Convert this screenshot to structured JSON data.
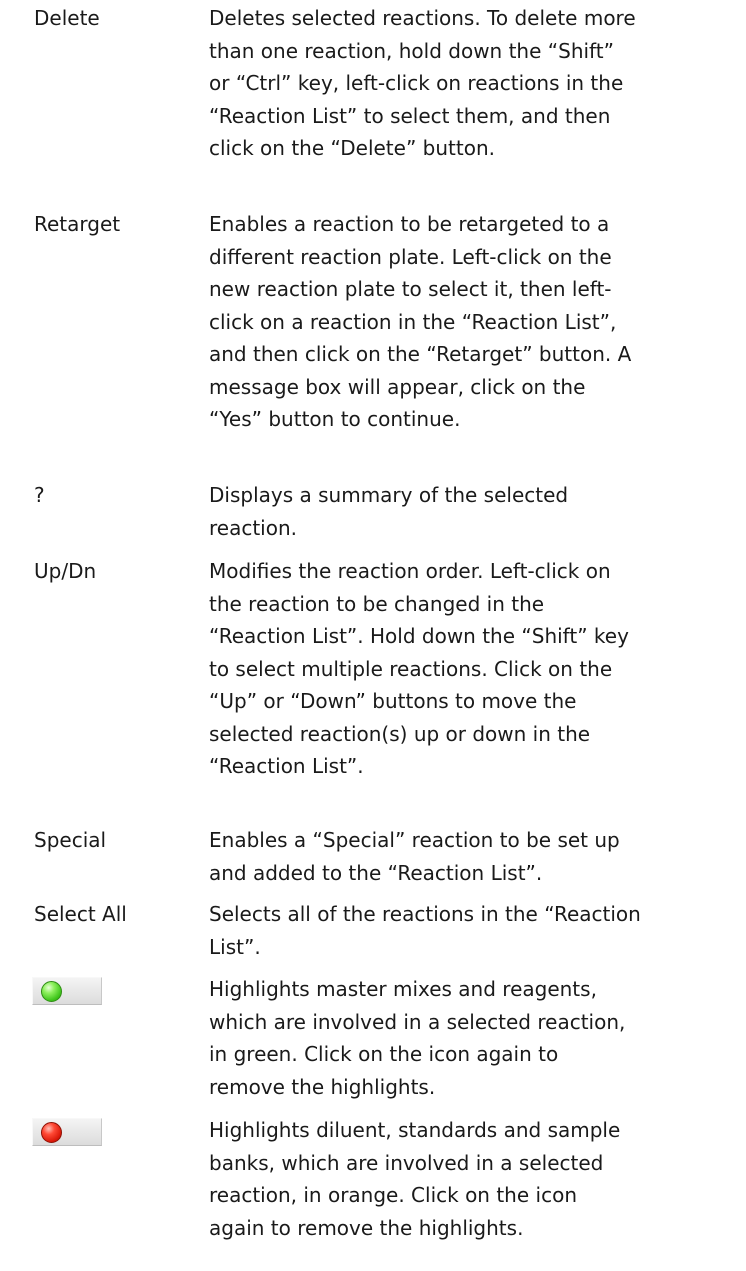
{
  "entries": [
    {
      "term": "Delete",
      "description": "Deletes selected reactions. To delete more\nthan one reaction, hold down the “Shift”\nor “Ctrl” key, left-click on reactions in the\n“Reaction List” to select them, and then\nclick on the “Delete” button."
    },
    {
      "term": "Retarget",
      "description": "Enables a reaction to be retargeted to a\ndifferent reaction plate. Left-click on the\nnew reaction plate to select it, then left-\nclick on a reaction in the “Reaction List”,\nand then click on the “Retarget” button. A\nmessage box will appear, click on the\n“Yes” button to continue."
    },
    {
      "term": "?",
      "description": "Displays a summary of the selected\nreaction."
    },
    {
      "term": "Up/Dn",
      "description": "Modifies the reaction order. Left-click on\nthe reaction to be changed in the\n“Reaction List”. Hold down the “Shift” key\nto select multiple reactions. Click on the\n“Up” or “Down” buttons to move the\nselected reaction(s) up or down in the\n“Reaction List”."
    },
    {
      "term": "Special",
      "description": "Enables a “Special” reaction to be set up\nand added to the “Reaction List”."
    },
    {
      "term": "Select All",
      "description": "Selects all of the reactions in the “Reaction\nList”."
    },
    {
      "icon": "green-circle-icon",
      "icon_color": "#3fc51b",
      "description": "Highlights master mixes and reagents,\nwhich are involved in a selected reaction,\nin green. Click on the icon again to\nremove the highlights."
    },
    {
      "icon": "red-circle-icon",
      "icon_color": "#d91808",
      "description": "Highlights diluent, standards and sample\nbanks, which are involved in a selected\nreaction, in orange. Click on the icon\nagain to remove the highlights."
    }
  ]
}
